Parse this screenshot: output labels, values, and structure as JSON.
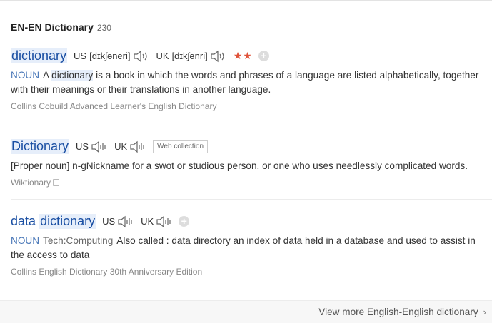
{
  "header": {
    "title": "EN-EN Dictionary",
    "count": "230"
  },
  "entries": [
    {
      "headword": "dictionary",
      "us_label": "US",
      "us_phonetic": "[dɪkʃəneri]",
      "uk_label": "UK",
      "uk_phonetic": "[dɪkʃənri]",
      "stars": "★★",
      "add": "+",
      "pos": "NOUN",
      "def_before": "A",
      "def_hl": "dictionary",
      "def_after": "is a book in which the words and phrases of a language are listed alphabetically, together with their meanings or their translations in another language.",
      "source": "Collins Cobuild Advanced Learner's English Dictionary"
    },
    {
      "headword": "Dictionary",
      "us_label": "US",
      "uk_label": "UK",
      "badge": "Web collection",
      "definition": "[Proper noun] n-gNickname for a swot or studious person, or one who uses needlessly complicated words.",
      "source": "Wiktionary"
    },
    {
      "headword_a": "data",
      "headword_b": "dictionary",
      "us_label": "US",
      "uk_label": "UK",
      "add": "+",
      "pos": "NOUN",
      "domain": "Tech:Computing",
      "definition": "Also called : data directory an index of data held in a database and used to assist in the access to data",
      "source": "Collins English Dictionary 30th Anniversary Edition"
    }
  ],
  "footer": {
    "more": "View more English-English dictionary",
    "chevron": "›"
  },
  "icons": [
    "speaker-icon",
    "plus-icon",
    "copy-icon",
    "chevron-right-icon"
  ],
  "colors": {
    "headword": "#1a4fa3",
    "highlight": "#e6eefa",
    "stars": "#e0533a",
    "pos": "#4a78b8"
  }
}
